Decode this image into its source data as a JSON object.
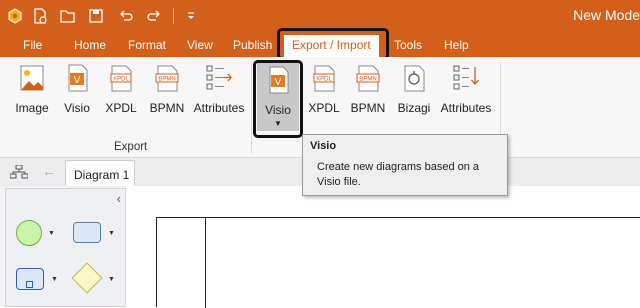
{
  "app": {
    "title": "New Mode"
  },
  "menubar": {
    "items": [
      {
        "label": "File"
      },
      {
        "label": "Home"
      },
      {
        "label": "Format"
      },
      {
        "label": "View"
      },
      {
        "label": "Publish"
      },
      {
        "label": "Export / Import"
      },
      {
        "label": "Tools"
      },
      {
        "label": "Help"
      }
    ],
    "active_tab": "Export / Import"
  },
  "ribbon": {
    "export_group": {
      "label": "Export",
      "buttons": [
        {
          "label": "Image",
          "icon": "image-icon"
        },
        {
          "label": "Visio",
          "icon": "visio-icon"
        },
        {
          "label": "XPDL",
          "icon": "xpdl-icon"
        },
        {
          "label": "BPMN",
          "icon": "bpmn-icon"
        },
        {
          "label": "Attributes",
          "icon": "attributes-icon"
        }
      ]
    },
    "import_group": {
      "buttons": [
        {
          "label": "Visio",
          "icon": "visio-icon"
        },
        {
          "label": "XPDL",
          "icon": "xpdl-icon"
        },
        {
          "label": "BPMN",
          "icon": "bpmn-icon"
        },
        {
          "label": "Bizagi",
          "icon": "bizagi-icon"
        },
        {
          "label": "Attributes",
          "icon": "attributes-icon"
        }
      ]
    }
  },
  "tooltip": {
    "title": "Visio",
    "description": "Create new diagrams based on a Visio file."
  },
  "document": {
    "tab_label": "Diagram 1"
  },
  "colors": {
    "accent": "#d2601a",
    "ribbon_bg": "#f7f7f7"
  }
}
